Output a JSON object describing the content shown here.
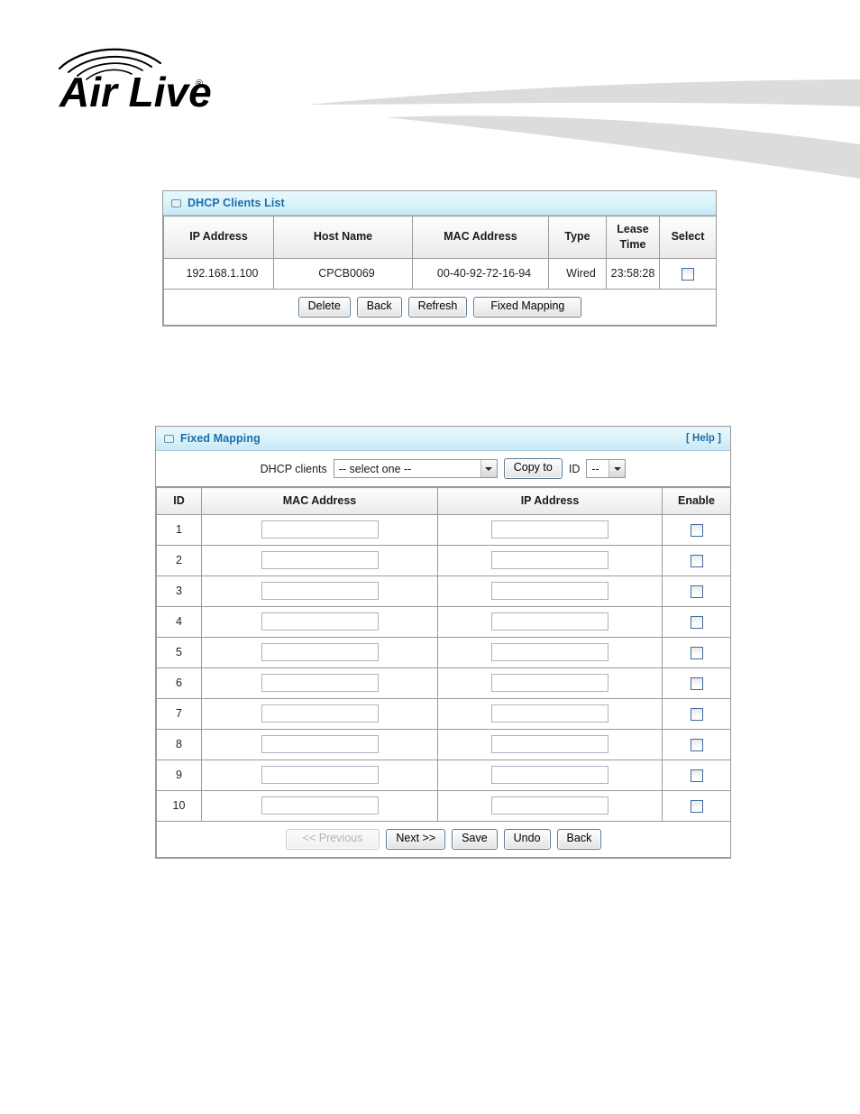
{
  "brand": {
    "name": "Air Live",
    "trademark": "®",
    "logo_icon": "airlive-logo"
  },
  "dhcp_clients_panel": {
    "title": "DHCP Clients List",
    "columns": [
      "IP Address",
      "Host Name",
      "MAC Address",
      "Type",
      "Lease Time",
      "Select"
    ],
    "rows": [
      {
        "ip_address": "192.168.1.100",
        "host_name": "CPCB0069",
        "mac_address": "00-40-92-72-16-94",
        "type": "Wired",
        "lease_time": "23:58:28",
        "selected": false
      }
    ],
    "buttons": [
      {
        "label": "Delete",
        "disabled": false
      },
      {
        "label": "Back",
        "disabled": false
      },
      {
        "label": "Refresh",
        "disabled": false
      },
      {
        "label": "Fixed Mapping",
        "disabled": false
      }
    ]
  },
  "fixed_mapping_panel": {
    "title": "Fixed Mapping",
    "help_label": "[ Help ]",
    "controls": {
      "dhcp_clients_label": "DHCP clients",
      "dhcp_clients_value": "-- select one --",
      "copy_to_label": "Copy to",
      "id_label": "ID",
      "id_value": "--"
    },
    "columns": [
      "ID",
      "MAC Address",
      "IP Address",
      "Enable"
    ],
    "rows": [
      {
        "id": "1",
        "mac_address": "",
        "ip_address": "",
        "enable": false
      },
      {
        "id": "2",
        "mac_address": "",
        "ip_address": "",
        "enable": false
      },
      {
        "id": "3",
        "mac_address": "",
        "ip_address": "",
        "enable": false
      },
      {
        "id": "4",
        "mac_address": "",
        "ip_address": "",
        "enable": false
      },
      {
        "id": "5",
        "mac_address": "",
        "ip_address": "",
        "enable": false
      },
      {
        "id": "6",
        "mac_address": "",
        "ip_address": "",
        "enable": false
      },
      {
        "id": "7",
        "mac_address": "",
        "ip_address": "",
        "enable": false
      },
      {
        "id": "8",
        "mac_address": "",
        "ip_address": "",
        "enable": false
      },
      {
        "id": "9",
        "mac_address": "",
        "ip_address": "",
        "enable": false
      },
      {
        "id": "10",
        "mac_address": "",
        "ip_address": "",
        "enable": false
      }
    ],
    "buttons": [
      {
        "label": "<< Previous",
        "disabled": true
      },
      {
        "label": "Next >>",
        "disabled": false
      },
      {
        "label": "Save",
        "disabled": false
      },
      {
        "label": "Undo",
        "disabled": false
      },
      {
        "label": "Back",
        "disabled": false
      }
    ]
  },
  "colors": {
    "panel_title_text": "#1b6ea8",
    "panel_border": "#9a9a9a",
    "header_gradient_top": "#e8f8fd",
    "header_gradient_bottom": "#c8e9f6",
    "swoosh": "#dcdcdc"
  }
}
